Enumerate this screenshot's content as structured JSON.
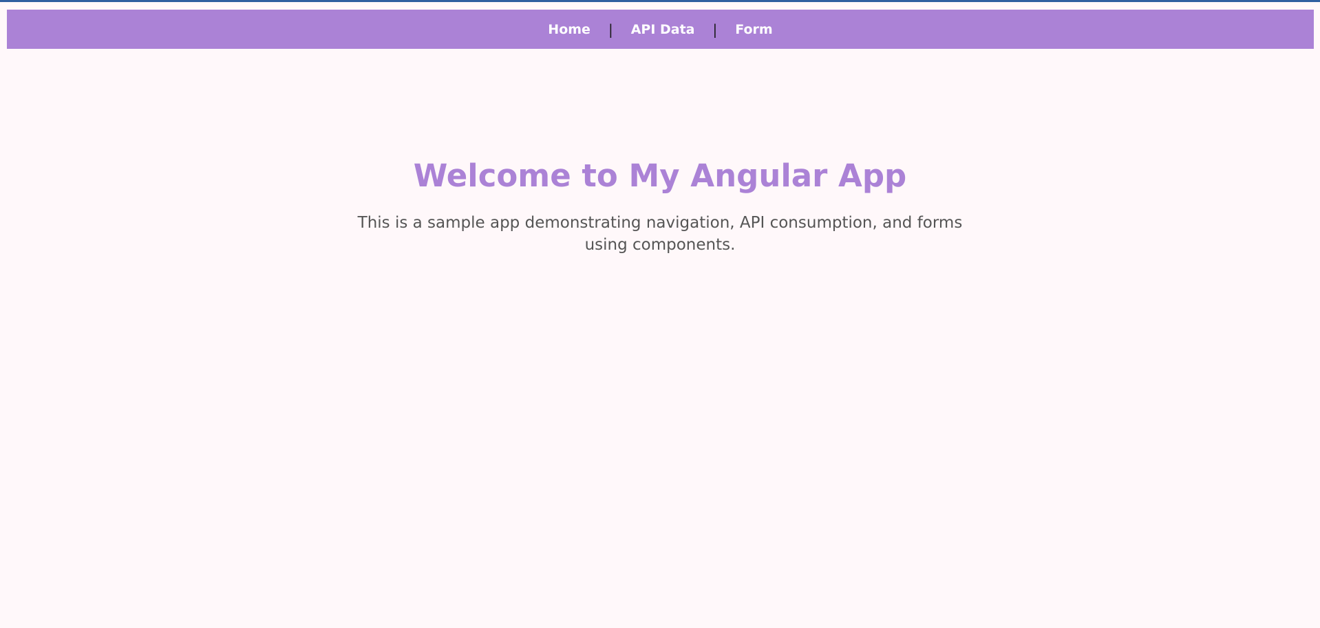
{
  "colors": {
    "accent": "#ab82d6",
    "background": "#fff8fa",
    "top_accent": "#2f5fa0",
    "body_text": "#555555"
  },
  "nav": {
    "items": [
      {
        "label": "Home"
      },
      {
        "label": "API Data"
      },
      {
        "label": "Form"
      }
    ],
    "separator": "|"
  },
  "hero": {
    "title": "Welcome to My Angular App",
    "description": "This is a sample app demonstrating navigation, API consumption, and forms using components."
  }
}
